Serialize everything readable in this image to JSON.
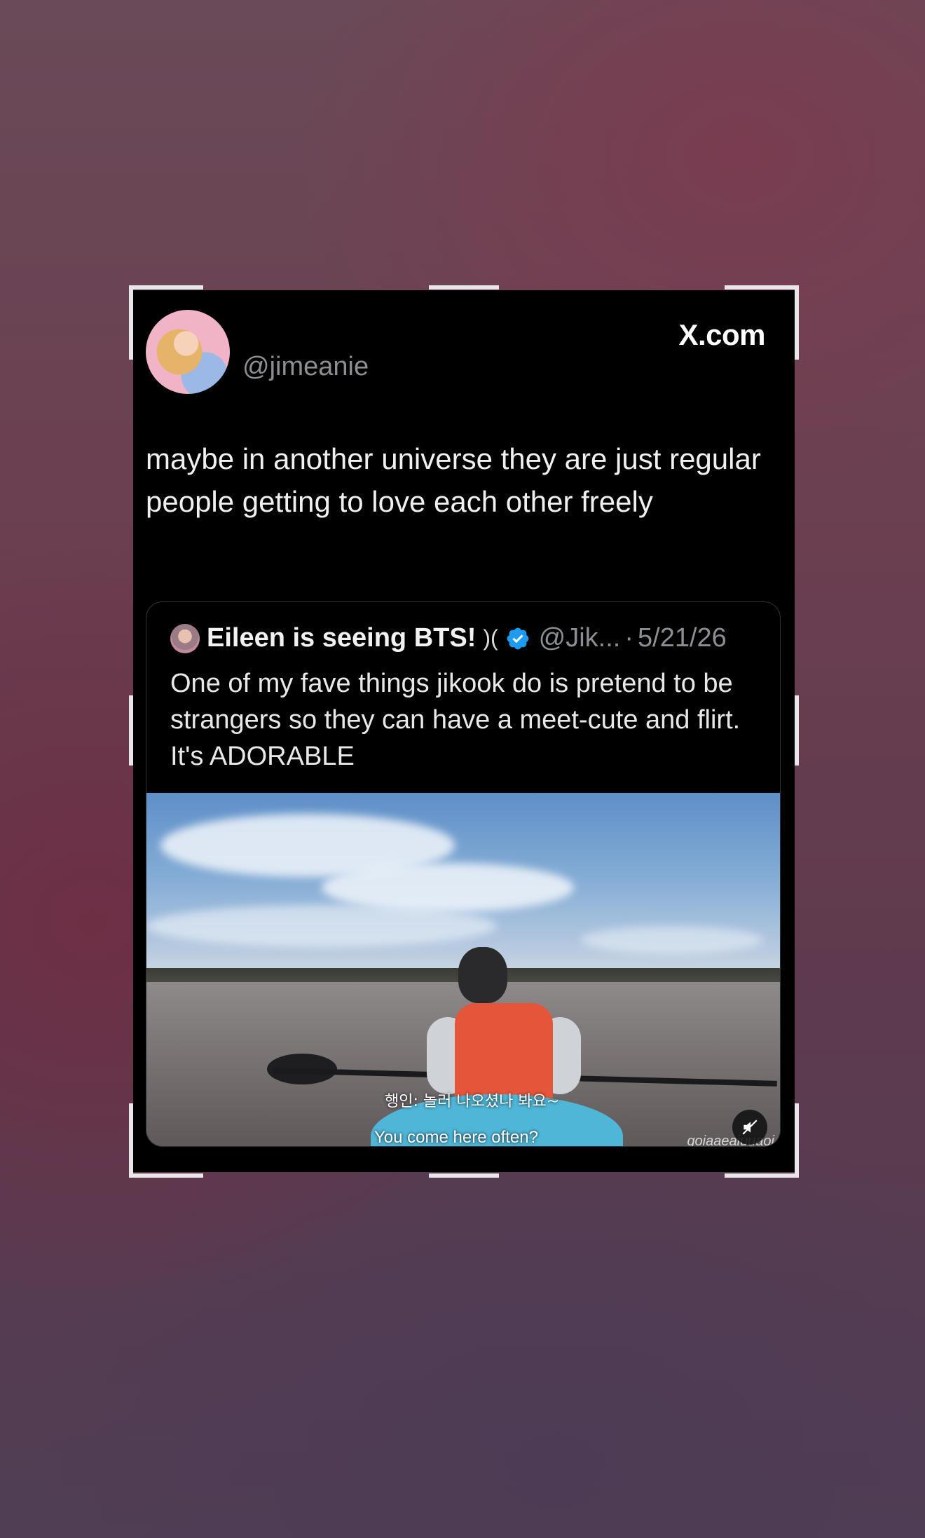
{
  "post": {
    "handle": "@jimeanie",
    "site": "X.com",
    "text": "maybe in another universe they are just regular people getting to love each other freely"
  },
  "quote": {
    "name": "Eileen is seeing BTS!",
    "name_glyph": ")(",
    "handle": "@Jik...",
    "separator": "·",
    "date": "5/21/26",
    "text": "One of my fave things jikook do is pretend to be strangers so they can have a meet-cute and flirt. It's ADORABLE",
    "verified_color": "#1d9bf0"
  },
  "video": {
    "subtitle_ko": "행인: 놀러 나오셨나 봐요~",
    "subtitle_en": "You come here often?",
    "watermark": "goiaaeaiuuaoi",
    "mute_icon": "speaker-muted-icon"
  }
}
